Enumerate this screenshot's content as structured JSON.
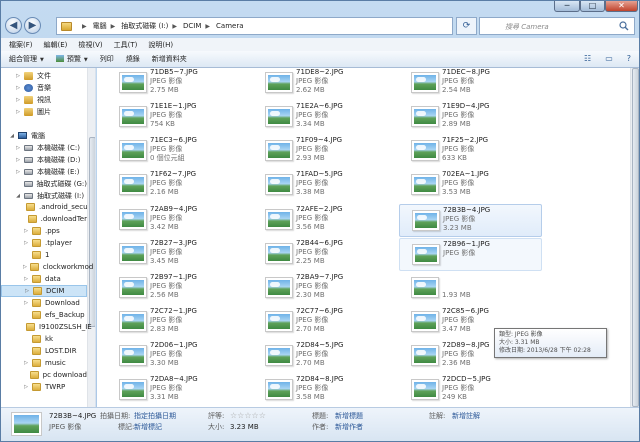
{
  "window": {
    "min_glyph": "─",
    "max_glyph": "□",
    "close_glyph": "✕"
  },
  "address": {
    "back_glyph": "◀",
    "fwd_glyph": "▶",
    "crumbs": [
      "電腦",
      "抽取式磁碟 (I:)",
      "DCIM",
      "Camera"
    ],
    "search_placeholder": "搜尋 Camera"
  },
  "menu": [
    "檔案(F)",
    "編輯(E)",
    "檢視(V)",
    "工具(T)",
    "說明(H)"
  ],
  "toolbar": {
    "organize": "組合管理",
    "preview": "預覽",
    "print": "列印",
    "email": "燒錄",
    "new_folder": "新增資料夾"
  },
  "sidebar": {
    "items": [
      {
        "label": "文件",
        "icon": "documents-icon",
        "indent": 2,
        "arrow": "▷"
      },
      {
        "label": "音樂",
        "icon": "music-icon",
        "indent": 2,
        "arrow": "▷"
      },
      {
        "label": "視訊",
        "icon": "videos-icon",
        "indent": 2,
        "arrow": "▷"
      },
      {
        "label": "圖片",
        "icon": "pictures-icon",
        "indent": 2,
        "arrow": "▷"
      },
      {
        "label": "",
        "icon": "",
        "indent": 0,
        "arrow": ""
      },
      {
        "label": "電腦",
        "icon": "computer-icon",
        "indent": 1,
        "arrow": "◢"
      },
      {
        "label": "本機磁碟 (C:)",
        "icon": "drive-icon",
        "indent": 2,
        "arrow": "▷"
      },
      {
        "label": "本機磁碟 (D:)",
        "icon": "drive-icon",
        "indent": 2,
        "arrow": "▷"
      },
      {
        "label": "本機磁碟 (E:)",
        "icon": "drive-icon",
        "indent": 2,
        "arrow": "▷"
      },
      {
        "label": "抽取式磁碟 (G:)",
        "icon": "drive-icon",
        "indent": 2,
        "arrow": ""
      },
      {
        "label": "抽取式磁碟 (I:)",
        "icon": "drive-icon",
        "indent": 2,
        "arrow": "◢"
      },
      {
        "label": ".android_secu",
        "icon": "folder-icon",
        "indent": 3,
        "arrow": ""
      },
      {
        "label": ".downloadTer",
        "icon": "folder-icon",
        "indent": 3,
        "arrow": ""
      },
      {
        "label": ".pps",
        "icon": "folder-icon",
        "indent": 3,
        "arrow": "▷"
      },
      {
        "label": ".tplayer",
        "icon": "folder-icon",
        "indent": 3,
        "arrow": "▷"
      },
      {
        "label": "1",
        "icon": "folder-icon",
        "indent": 3,
        "arrow": ""
      },
      {
        "label": "clockworkmod",
        "icon": "folder-icon",
        "indent": 3,
        "arrow": "▷"
      },
      {
        "label": "data",
        "icon": "folder-icon",
        "indent": 3,
        "arrow": "▷"
      },
      {
        "label": "DCIM",
        "icon": "folder-icon",
        "indent": 3,
        "arrow": "▷",
        "selected": true
      },
      {
        "label": "Download",
        "icon": "folder-icon",
        "indent": 3,
        "arrow": "▷"
      },
      {
        "label": "efs_Backup",
        "icon": "folder-icon",
        "indent": 3,
        "arrow": ""
      },
      {
        "label": "I9100ZSLSH_IE",
        "icon": "folder-icon",
        "indent": 3,
        "arrow": ""
      },
      {
        "label": "kk",
        "icon": "folder-icon",
        "indent": 3,
        "arrow": ""
      },
      {
        "label": "LOST.DIR",
        "icon": "folder-icon",
        "indent": 3,
        "arrow": ""
      },
      {
        "label": "music",
        "icon": "folder-icon",
        "indent": 3,
        "arrow": "▷"
      },
      {
        "label": "pc download",
        "icon": "folder-icon",
        "indent": 3,
        "arrow": ""
      },
      {
        "label": "TWRP",
        "icon": "folder-icon",
        "indent": 3,
        "arrow": "▷"
      }
    ]
  },
  "files": [
    {
      "name": "71DB5~7.JPG",
      "type": "JPEG 影像",
      "size": "2.75 MB"
    },
    {
      "name": "71DE8~2.JPG",
      "type": "JPEG 影像",
      "size": "2.62 MB"
    },
    {
      "name": "71DEC~8.JPG",
      "type": "JPEG 影像",
      "size": "2.54 MB"
    },
    {
      "name": "71E1E~1.JPG",
      "type": "JPEG 影像",
      "size": "754 KB"
    },
    {
      "name": "71E2A~6.JPG",
      "type": "JPEG 影像",
      "size": "3.34 MB"
    },
    {
      "name": "71E9D~4.JPG",
      "type": "JPEG 影像",
      "size": "2.89 MB"
    },
    {
      "name": "71EC3~6.JPG",
      "type": "JPEG 影像",
      "size": "0 個位元組"
    },
    {
      "name": "71F09~4.JPG",
      "type": "JPEG 影像",
      "size": "2.93 MB"
    },
    {
      "name": "71F25~2.JPG",
      "type": "JPEG 影像",
      "size": "633 KB"
    },
    {
      "name": "71F62~7.JPG",
      "type": "JPEG 影像",
      "size": "2.16 MB"
    },
    {
      "name": "71FAD~5.JPG",
      "type": "JPEG 影像",
      "size": "3.38 MB"
    },
    {
      "name": "702EA~1.JPG",
      "type": "JPEG 影像",
      "size": "3.53 MB"
    },
    {
      "name": "72AB9~4.JPG",
      "type": "JPEG 影像",
      "size": "3.42 MB"
    },
    {
      "name": "72AFE~2.JPG",
      "type": "JPEG 影像",
      "size": "3.56 MB"
    },
    {
      "name": "72B3B~4.JPG",
      "type": "JPEG 影像",
      "size": "3.23 MB",
      "state": "sel"
    },
    {
      "name": "72B27~3.JPG",
      "type": "JPEG 影像",
      "size": "3.45 MB"
    },
    {
      "name": "72B44~6.JPG",
      "type": "JPEG 影像",
      "size": "2.25 MB"
    },
    {
      "name": "72B96~1.JPG",
      "type": "JPEG 影像",
      "size": "",
      "state": "hov"
    },
    {
      "name": "72B97~1.JPG",
      "type": "JPEG 影像",
      "size": "2.56 MB"
    },
    {
      "name": "72BA9~7.JPG",
      "type": "JPEG 影像",
      "size": "2.30 MB"
    },
    {
      "name": "",
      "type": "",
      "size": "1.93 MB"
    },
    {
      "name": "72C72~1.JPG",
      "type": "JPEG 影像",
      "size": "2.83 MB"
    },
    {
      "name": "72C77~6.JPG",
      "type": "JPEG 影像",
      "size": "2.70 MB"
    },
    {
      "name": "72C85~6.JPG",
      "type": "JPEG 影像",
      "size": "3.47 MB"
    },
    {
      "name": "72D06~1.JPG",
      "type": "JPEG 影像",
      "size": "3.30 MB"
    },
    {
      "name": "72D84~5.JPG",
      "type": "JPEG 影像",
      "size": "2.70 MB"
    },
    {
      "name": "72D89~8.JPG",
      "type": "JPEG 影像",
      "size": "2.36 MB"
    },
    {
      "name": "72DA8~4.JPG",
      "type": "JPEG 影像",
      "size": "3.31 MB"
    },
    {
      "name": "72D84~8.JPG",
      "type": "JPEG 影像",
      "size": "3.58 MB"
    },
    {
      "name": "72DCD~5.JPG",
      "type": "JPEG 影像",
      "size": "249 KB"
    }
  ],
  "tooltip": {
    "type": "類型: JPEG 影像",
    "size": "大小: 3.31 MB",
    "date": "修改日期: 2013/6/28 下午 02:28"
  },
  "status": {
    "name": "72B3B~4.JPG",
    "type": "JPEG 影像",
    "date_label": "拍攝日期:",
    "date_value": "指定拍攝日期",
    "tags_label": "標記:",
    "tags_value": "新增標記",
    "rating_label": "評等:",
    "stars": "☆☆☆☆☆",
    "rating": 0,
    "size_label": "大小:",
    "size_value": "3.23 MB",
    "title_label": "標題:",
    "title_value": "新增標題",
    "authors_label": "作者:",
    "authors_value": "新增作者",
    "comments_label": "註解:",
    "comments_value": "新增註解"
  }
}
